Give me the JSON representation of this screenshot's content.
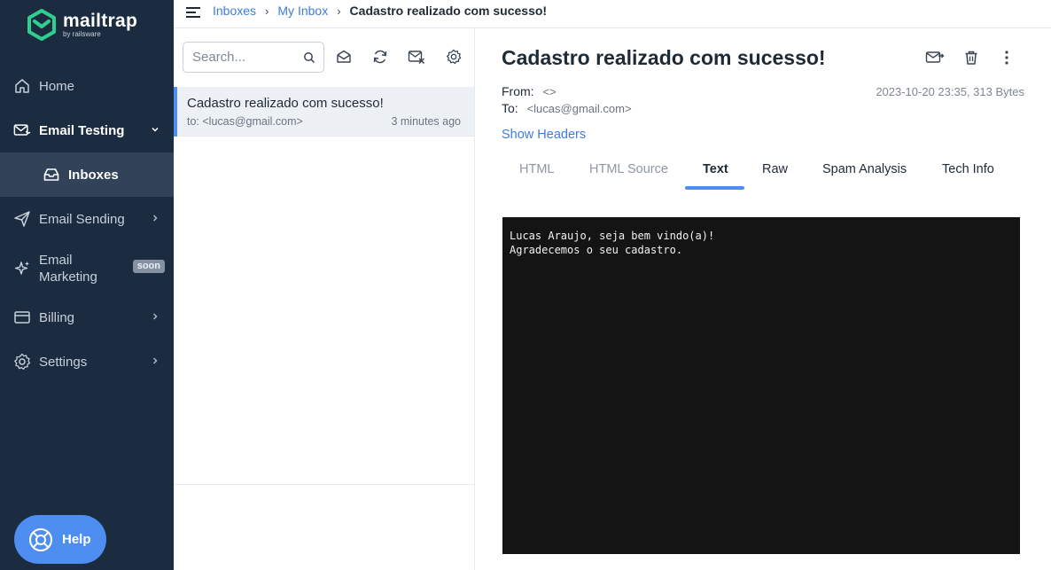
{
  "brand": {
    "name": "mailtrap",
    "sub": "by railsware",
    "color": "#2fd08f"
  },
  "sidebar": {
    "items": [
      {
        "label": "Home",
        "icon": "home-icon"
      },
      {
        "label": "Email Testing",
        "icon": "email-testing-icon",
        "active": true
      },
      {
        "label": "Inboxes",
        "icon": "inbox-icon",
        "selected": true
      },
      {
        "label": "Email Sending",
        "icon": "send-icon"
      },
      {
        "label": "Email",
        "label2": "Marketing",
        "badge": "soon",
        "icon": "sparkle-icon"
      },
      {
        "label": "Billing",
        "icon": "card-icon"
      },
      {
        "label": "Settings",
        "icon": "gear-icon"
      }
    ],
    "help_label": "Help"
  },
  "breadcrumb": {
    "items": [
      "Inboxes",
      "My Inbox"
    ],
    "current": "Cadastro realizado com sucesso!",
    "separator": "›"
  },
  "list": {
    "search_placeholder": "Search...",
    "messages": [
      {
        "subject": "Cadastro realizado com sucesso!",
        "to": "to: <lucas@gmail.com>",
        "time": "3 minutes ago"
      }
    ]
  },
  "detail": {
    "title": "Cadastro realizado com sucesso!",
    "from_label": "From:",
    "from_value": "<>",
    "to_label": "To:",
    "to_value": "<lucas@gmail.com>",
    "meta": "2023-10-20 23:35, 313 Bytes",
    "show_headers": "Show Headers",
    "tabs": [
      "HTML",
      "HTML Source",
      "Text",
      "Raw",
      "Spam Analysis",
      "Tech Info"
    ],
    "active_tab": "Text",
    "body_text": "Lucas Araujo, seja bem vindo(a)!\nAgradecemos o seu cadastro."
  },
  "colors": {
    "sidebar_bg": "#1c2c40",
    "accent": "#4e8ef0",
    "selected_bg": "#324359",
    "body_bg": "#141414"
  }
}
